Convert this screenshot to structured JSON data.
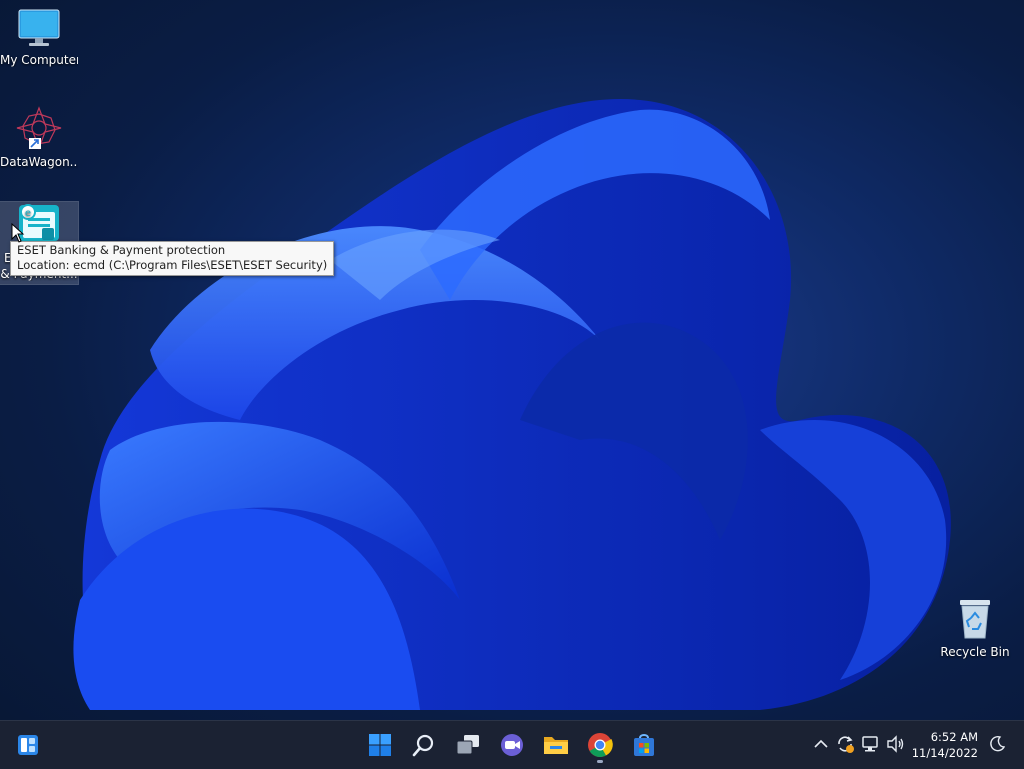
{
  "desktop": {
    "icons": [
      {
        "label": "My Computer"
      },
      {
        "label": "DataWagon..."
      },
      {
        "label": "ESET Banking & Payment...",
        "label_line1": "E",
        "label_line2": "& Payment..."
      },
      {
        "label": "Recycle Bin"
      }
    ],
    "tooltip": {
      "line1": "ESET Banking & Payment protection",
      "line2": "Location: ecmd (C:\\Program Files\\ESET\\ESET Security)"
    }
  },
  "taskbar": {
    "pinned": [
      "widgets-icon",
      "start-icon",
      "search-icon",
      "task-view-icon",
      "chat-icon",
      "file-explorer-icon",
      "chrome-icon",
      "store-icon"
    ],
    "clock": {
      "time": "6:52 AM",
      "date": "11/14/2022"
    },
    "tray": [
      "chevron-up-icon",
      "update-icon",
      "network-icon",
      "volume-icon",
      "focus-assist-icon"
    ]
  },
  "colors": {
    "accent": "#1f6fff",
    "taskbar": "#1b2233"
  }
}
